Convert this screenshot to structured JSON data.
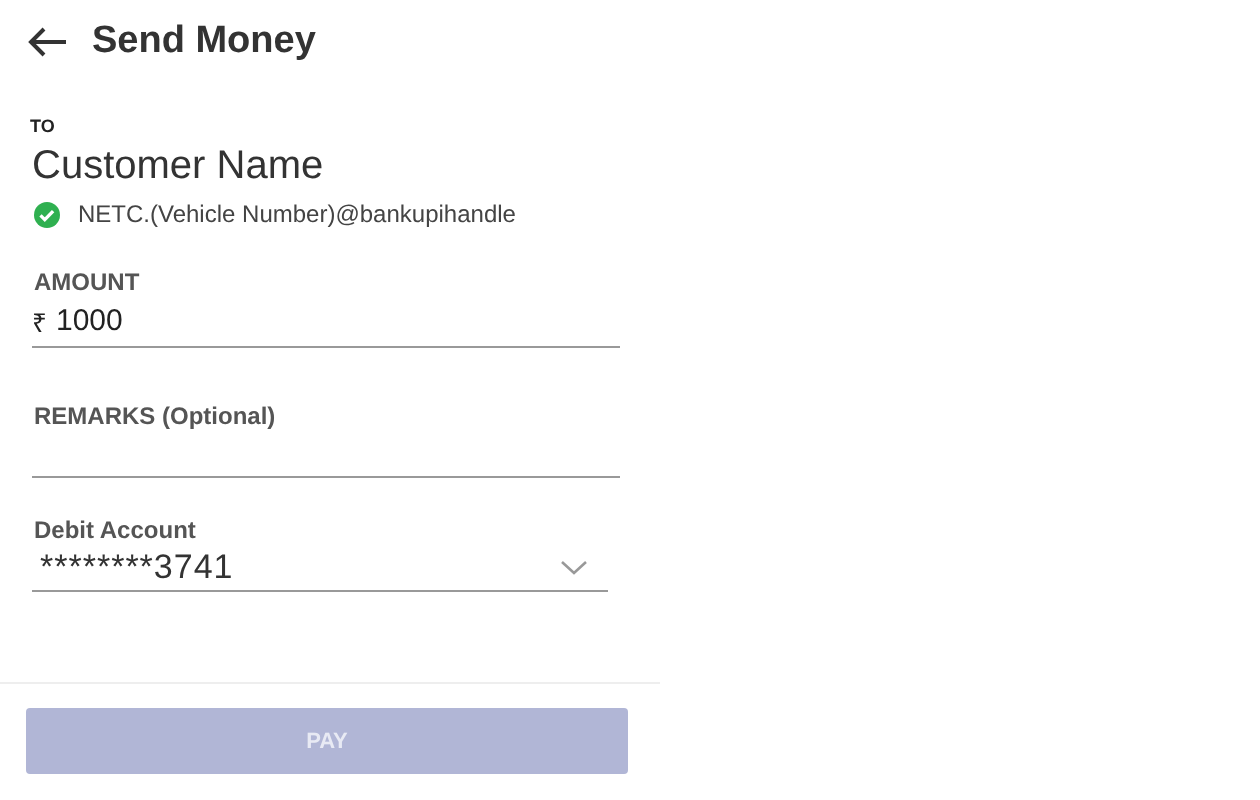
{
  "header": {
    "title": "Send Money"
  },
  "recipient": {
    "label": "TO",
    "name": "Customer Name",
    "upi_id": "NETC.(Vehicle Number)@bankupihandle",
    "verified": true
  },
  "amount": {
    "label": "AMOUNT",
    "currency": "₹",
    "value": "1000"
  },
  "remarks": {
    "label": "REMARKS (Optional)"
  },
  "debit_account": {
    "label": "Debit Account",
    "value": "********3741"
  },
  "pay_button": {
    "label": "PAY",
    "disabled": true
  }
}
